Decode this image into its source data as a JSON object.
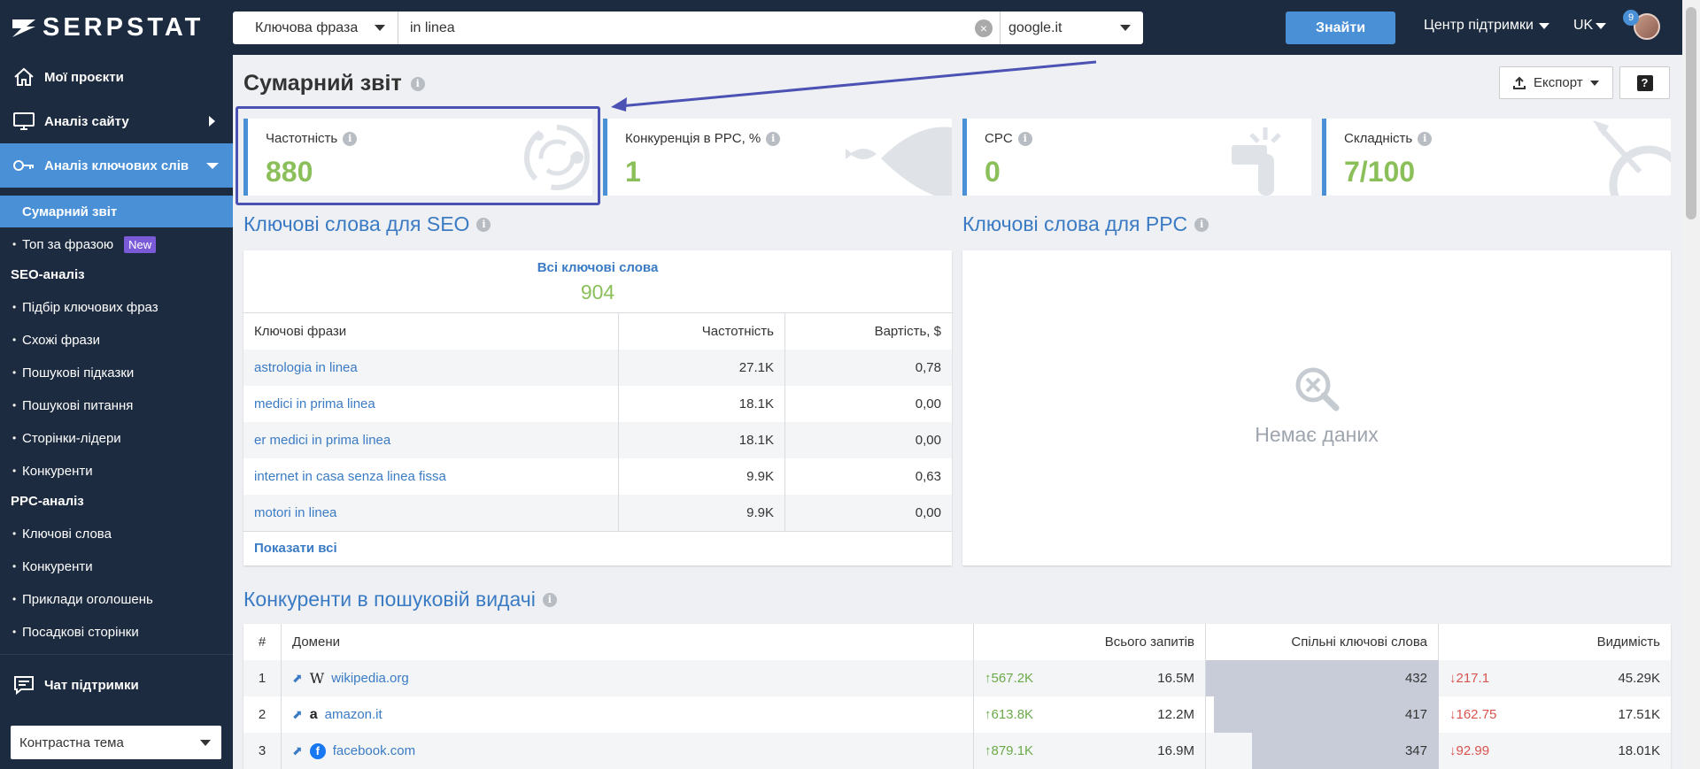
{
  "header": {
    "logo": "SERPSTAT",
    "search_type": "Ключова фраза",
    "search_value": "in linea",
    "database": "google.it",
    "find_label": "Знайти",
    "help_center": "Центр підтримки",
    "lang": "UK",
    "notif_count": "9"
  },
  "sidebar": {
    "main": [
      {
        "label": "Мої проєкти",
        "icon": "home-icon"
      },
      {
        "label": "Аналіз сайту",
        "icon": "monitor-icon"
      },
      {
        "label": "Аналіз ключових слів",
        "icon": "key-icon"
      }
    ],
    "current": "Сумарний звіт",
    "top_phrase": "Топ за фразою",
    "new_badge": "New",
    "seo_head": "SEO-аналіз",
    "seo_items": [
      "Підбір ключових фраз",
      "Схожі фрази",
      "Пошукові підказки",
      "Пошукові питання",
      "Сторінки-лідери",
      "Конкуренти"
    ],
    "ppc_head": "PPC-аналіз",
    "ppc_items": [
      "Ключові слова",
      "Конкуренти",
      "Приклади оголошень",
      "Посадкові сторінки"
    ],
    "chat": "Чат підтримки",
    "theme": "Контрастна тема"
  },
  "page": {
    "title": "Сумарний звіт",
    "export": "Експорт",
    "help": "?"
  },
  "cards": [
    {
      "label": "Частотність",
      "value": "880"
    },
    {
      "label": "Конкуренція в PPC, %",
      "value": "1"
    },
    {
      "label": "CPC",
      "value": "0"
    },
    {
      "label": "Складність",
      "value": "7/100"
    }
  ],
  "seo": {
    "title": "Ключові слова для SEO",
    "all_label": "Всі ключові слова",
    "all_count": "904",
    "columns": [
      "Ключові фрази",
      "Частотність",
      "Вартість, $"
    ],
    "rows": [
      [
        "astrologia in linea",
        "27.1K",
        "0,78"
      ],
      [
        "medici in prima linea",
        "18.1K",
        "0,00"
      ],
      [
        "er medici in prima linea",
        "18.1K",
        "0,00"
      ],
      [
        "internet in casa senza linea fissa",
        "9.9K",
        "0,63"
      ],
      [
        "motori in linea",
        "9.9K",
        "0,00"
      ]
    ],
    "show_all": "Показати всі"
  },
  "ppc": {
    "title": "Ключові слова для PPC",
    "no_data": "Немає даних"
  },
  "competitors": {
    "title": "Конкуренти в пошуковій видачі",
    "columns": [
      "#",
      "Домени",
      "Всього запитів",
      "Спільні ключові слова",
      "Видимість"
    ],
    "rows": [
      {
        "n": "1",
        "domain": "wikipedia.org",
        "delta": "↑567.2K",
        "total": "16.5M",
        "common": "432",
        "common_share": 1.0,
        "vis_delta": "↓217.1",
        "visibility": "45.29K"
      },
      {
        "n": "2",
        "domain": "amazon.it",
        "delta": "↑613.8K",
        "total": "12.2M",
        "common": "417",
        "common_share": 0.965,
        "vis_delta": "↓162.75",
        "visibility": "17.51K"
      },
      {
        "n": "3",
        "domain": "facebook.com",
        "delta": "↑879.1K",
        "total": "16.9M",
        "common": "347",
        "common_share": 0.803,
        "vis_delta": "↓92.99",
        "visibility": "18.01K"
      }
    ]
  },
  "colors": {
    "header_bg": "#1c2b3f",
    "accent": "#4a90d6",
    "value_green": "#8bbf5a",
    "link_blue": "#3a7bc4",
    "highlight": "#4b52b3"
  }
}
